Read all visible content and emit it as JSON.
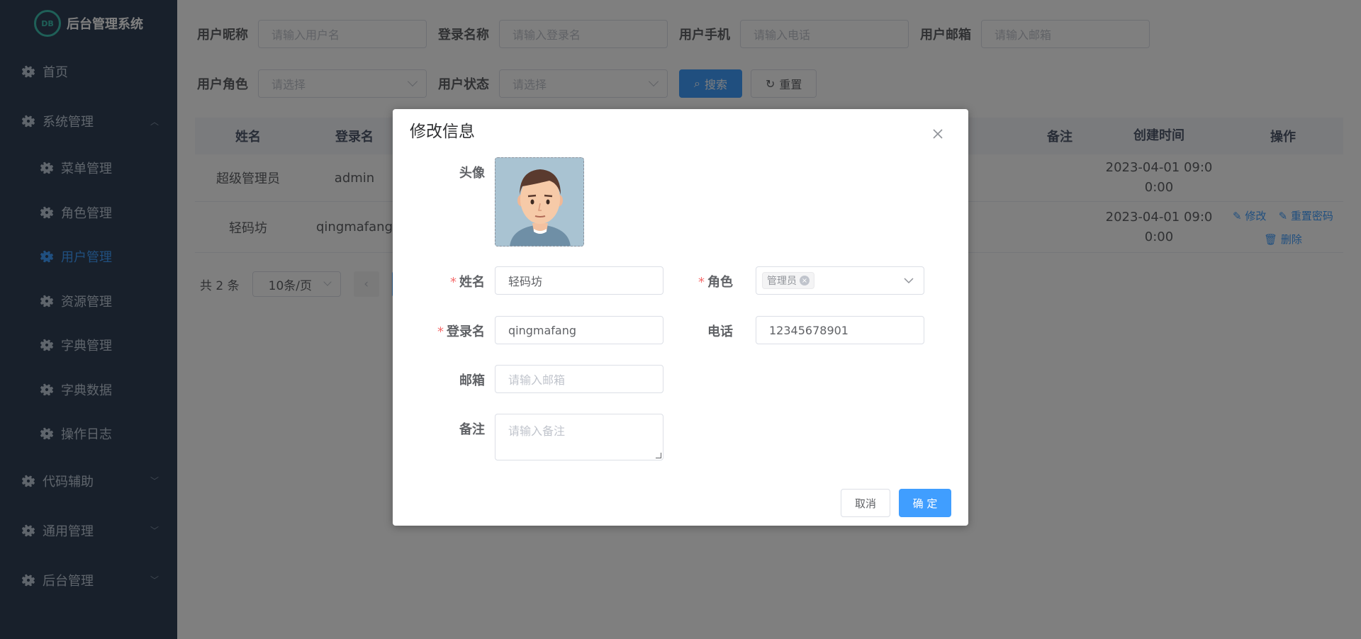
{
  "sidebar": {
    "title": "后台管理系统",
    "logo_text": "DB",
    "items": [
      {
        "label": "首页"
      },
      {
        "label": "系统管理"
      },
      {
        "label": "菜单管理"
      },
      {
        "label": "角色管理"
      },
      {
        "label": "用户管理"
      },
      {
        "label": "资源管理"
      },
      {
        "label": "字典管理"
      },
      {
        "label": "字典数据"
      },
      {
        "label": "操作日志"
      },
      {
        "label": "代码辅助"
      },
      {
        "label": "通用管理"
      },
      {
        "label": "后台管理"
      }
    ]
  },
  "search": {
    "nickname_label": "用户昵称",
    "nickname_placeholder": "请输入用户名",
    "login_label": "登录名称",
    "login_placeholder": "请输入登录名",
    "phone_label": "用户手机",
    "phone_placeholder": "请输入电话",
    "email_label": "用户邮箱",
    "email_placeholder": "请输入邮箱",
    "role_label": "用户角色",
    "role_placeholder": "请选择",
    "status_label": "用户状态",
    "status_placeholder": "请选择",
    "search_button": "搜索",
    "reset_button": "重置"
  },
  "table": {
    "headers": {
      "name": "姓名",
      "login": "登录名",
      "note": "备注",
      "time": "创建时间",
      "ops": "操作"
    },
    "rows": [
      {
        "name": "超级管理员",
        "login": "admin",
        "time_line1": "2023-04-01 09:0",
        "time_line2": "0:00"
      },
      {
        "name": "轻码坊",
        "login": "qingmafang",
        "time_line1": "2023-04-01 09:0",
        "time_line2": "0:00",
        "op_edit": "修改",
        "op_reset": "重置密码",
        "op_delete": "删除"
      }
    ]
  },
  "pager": {
    "total": "共 2 条",
    "size": "10条/页",
    "prev": "‹"
  },
  "dialog": {
    "title": "修改信息",
    "avatar_label": "头像",
    "name_label": "姓名",
    "name_value": "轻码坊",
    "role_label": "角色",
    "role_tag": "管理员",
    "login_label": "登录名",
    "login_value": "qingmafang",
    "phone_label": "电话",
    "phone_value": "12345678901",
    "email_label": "邮箱",
    "email_placeholder": "请输入邮箱",
    "note_label": "备注",
    "note_placeholder": "请输入备注",
    "required_mark": "*",
    "cancel_button": "取消",
    "ok_button": "确 定"
  }
}
